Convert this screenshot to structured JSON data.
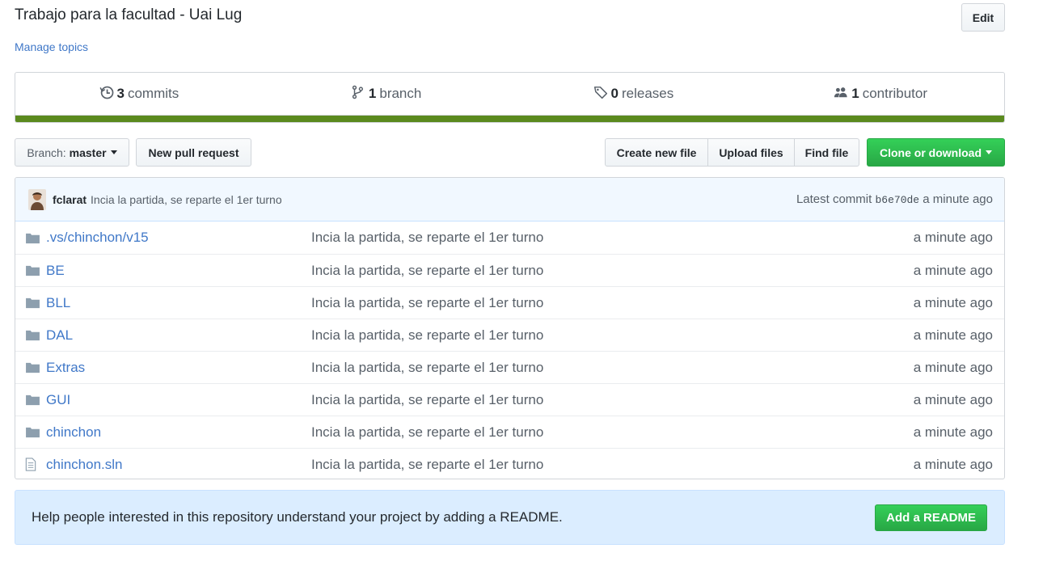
{
  "repo": {
    "description": "Trabajo para la facultad - Uai Lug",
    "edit_label": "Edit",
    "manage_topics": "Manage topics"
  },
  "summary": {
    "commits_count": "3",
    "commits_label": "commits",
    "branch_count": "1",
    "branch_label": "branch",
    "releases_count": "0",
    "releases_label": "releases",
    "contributor_count": "1",
    "contributor_label": "contributor",
    "language_color": "#5b8a1e"
  },
  "toolbar": {
    "branch_prefix": "Branch:",
    "branch_name": "master",
    "new_pull_request": "New pull request",
    "create_new_file": "Create new file",
    "upload_files": "Upload files",
    "find_file": "Find file",
    "clone_or_download": "Clone or download"
  },
  "latest_commit": {
    "author": "fclarat",
    "message": "Incia la partida, se reparte el 1er turno",
    "prefix": "Latest commit",
    "sha": "b6e70de",
    "age": "a minute ago"
  },
  "files": [
    {
      "type": "folder",
      "name": ".vs/chinchon/v15",
      "message": "Incia la partida, se reparte el 1er turno",
      "age": "a minute ago"
    },
    {
      "type": "folder",
      "name": "BE",
      "message": "Incia la partida, se reparte el 1er turno",
      "age": "a minute ago"
    },
    {
      "type": "folder",
      "name": "BLL",
      "message": "Incia la partida, se reparte el 1er turno",
      "age": "a minute ago"
    },
    {
      "type": "folder",
      "name": "DAL",
      "message": "Incia la partida, se reparte el 1er turno",
      "age": "a minute ago"
    },
    {
      "type": "folder",
      "name": "Extras",
      "message": "Incia la partida, se reparte el 1er turno",
      "age": "a minute ago"
    },
    {
      "type": "folder",
      "name": "GUI",
      "message": "Incia la partida, se reparte el 1er turno",
      "age": "a minute ago"
    },
    {
      "type": "folder",
      "name": "chinchon",
      "message": "Incia la partida, se reparte el 1er turno",
      "age": "a minute ago"
    },
    {
      "type": "file",
      "name": "chinchon.sln",
      "message": "Incia la partida, se reparte el 1er turno",
      "age": "a minute ago"
    }
  ],
  "readme": {
    "text": "Help people interested in this repository understand your project by adding a README.",
    "button": "Add a README"
  }
}
